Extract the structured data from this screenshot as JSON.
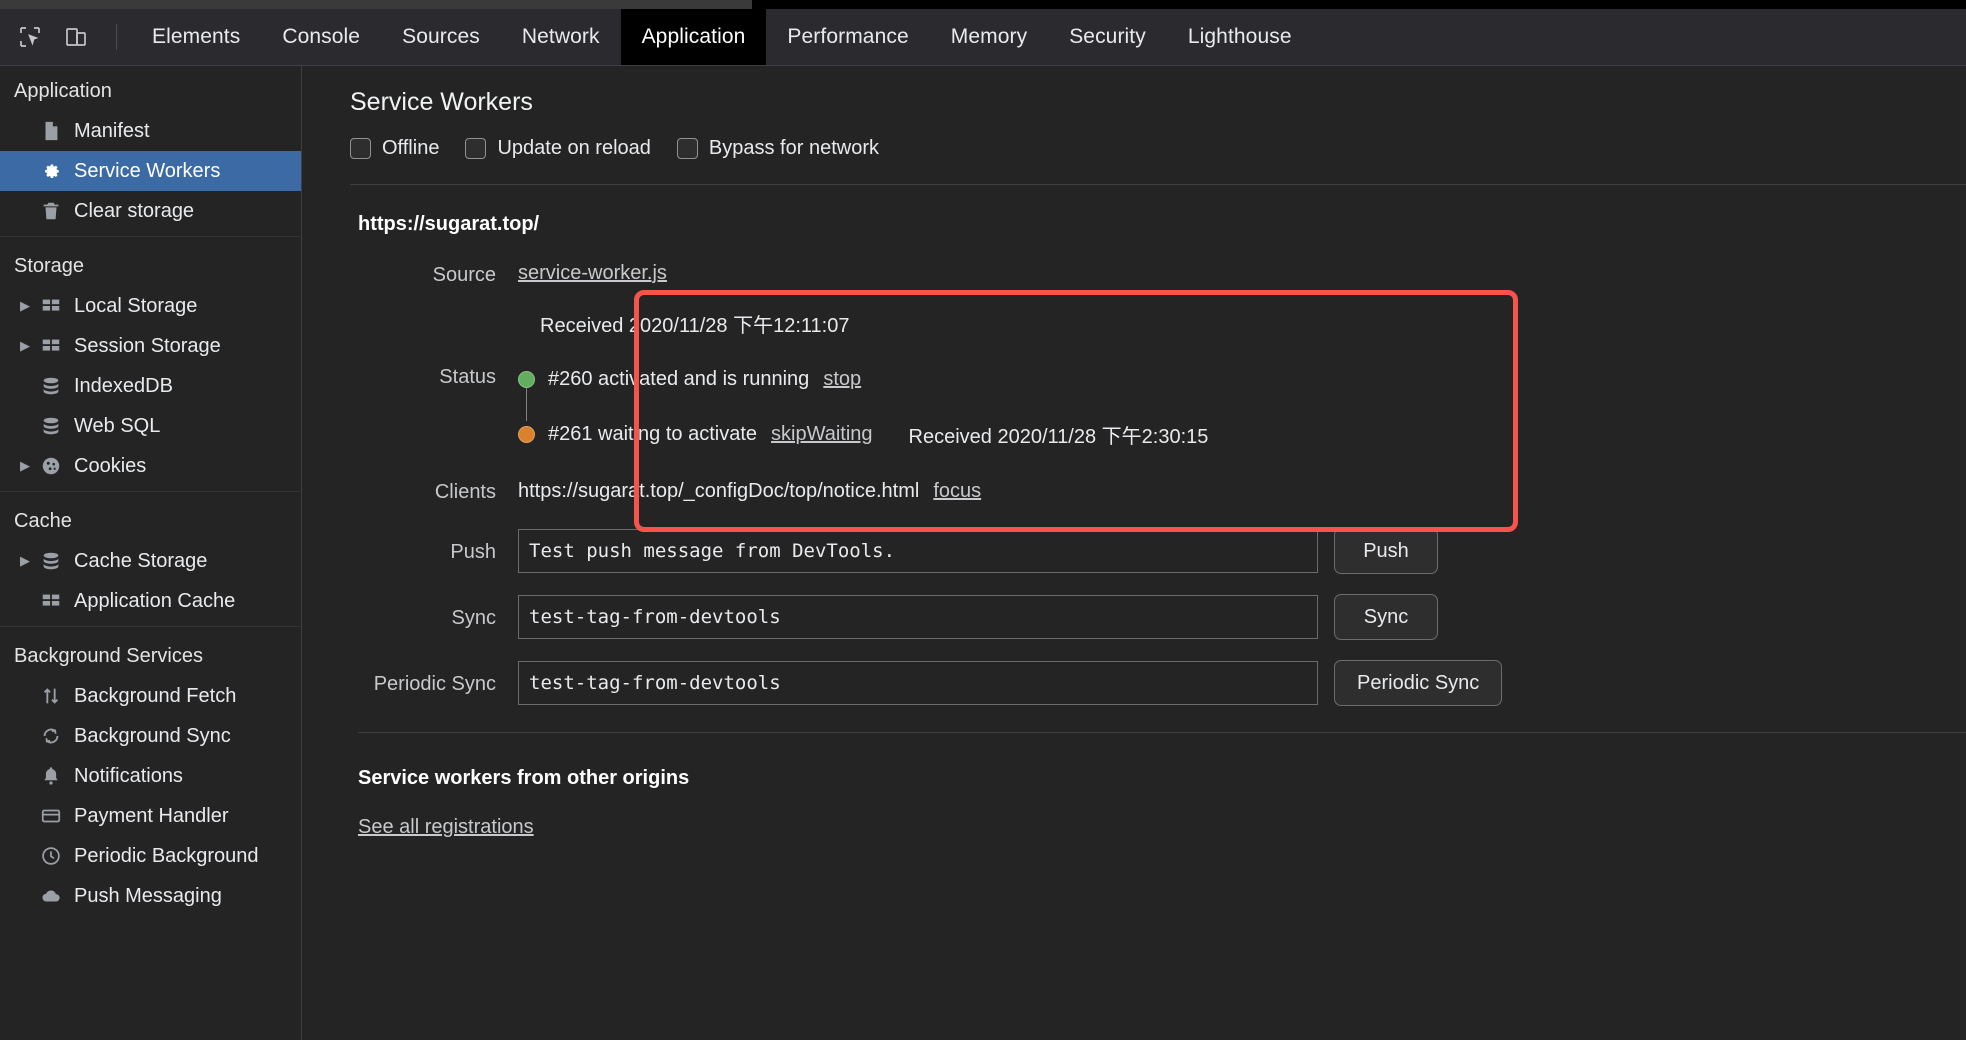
{
  "window": {
    "tools": [
      {
        "name": "inspect-element-icon",
        "title": "Inspect element"
      },
      {
        "name": "device-toolbar-icon",
        "title": "Toggle device toolbar"
      }
    ]
  },
  "tabs": [
    {
      "label": "Elements",
      "active": false
    },
    {
      "label": "Console",
      "active": false
    },
    {
      "label": "Sources",
      "active": false
    },
    {
      "label": "Network",
      "active": false
    },
    {
      "label": "Application",
      "active": true
    },
    {
      "label": "Performance",
      "active": false
    },
    {
      "label": "Memory",
      "active": false
    },
    {
      "label": "Security",
      "active": false
    },
    {
      "label": "Lighthouse",
      "active": false
    }
  ],
  "sidebar": {
    "groups": [
      {
        "header": "Application",
        "items": [
          {
            "label": "Manifest",
            "icon": "document-icon",
            "twisty": false,
            "selected": false
          },
          {
            "label": "Service Workers",
            "icon": "gear-icon",
            "twisty": false,
            "selected": true
          },
          {
            "label": "Clear storage",
            "icon": "trash-icon",
            "twisty": false,
            "selected": false
          }
        ]
      },
      {
        "header": "Storage",
        "items": [
          {
            "label": "Local Storage",
            "icon": "table-icon",
            "twisty": true,
            "selected": false
          },
          {
            "label": "Session Storage",
            "icon": "table-icon",
            "twisty": true,
            "selected": false
          },
          {
            "label": "IndexedDB",
            "icon": "database-icon",
            "twisty": false,
            "selected": false
          },
          {
            "label": "Web SQL",
            "icon": "database-icon",
            "twisty": false,
            "selected": false
          },
          {
            "label": "Cookies",
            "icon": "cookie-icon",
            "twisty": true,
            "selected": false
          }
        ]
      },
      {
        "header": "Cache",
        "items": [
          {
            "label": "Cache Storage",
            "icon": "database-icon",
            "twisty": true,
            "selected": false
          },
          {
            "label": "Application Cache",
            "icon": "table-icon",
            "twisty": false,
            "selected": false
          }
        ]
      },
      {
        "header": "Background Services",
        "items": [
          {
            "label": "Background Fetch",
            "icon": "fetch-arrows-icon",
            "twisty": false,
            "selected": false
          },
          {
            "label": "Background Sync",
            "icon": "sync-icon",
            "twisty": false,
            "selected": false
          },
          {
            "label": "Notifications",
            "icon": "bell-icon",
            "twisty": false,
            "selected": false
          },
          {
            "label": "Payment Handler",
            "icon": "credit-card-icon",
            "twisty": false,
            "selected": false
          },
          {
            "label": "Periodic Background",
            "icon": "clock-icon",
            "twisty": false,
            "selected": false
          },
          {
            "label": "Push Messaging",
            "icon": "cloud-icon",
            "twisty": false,
            "selected": false
          }
        ]
      }
    ]
  },
  "main": {
    "title": "Service Workers",
    "checkboxes": [
      {
        "label": "Offline",
        "checked": false
      },
      {
        "label": "Update on reload",
        "checked": false
      },
      {
        "label": "Bypass for network",
        "checked": false
      }
    ],
    "registration": {
      "origin": "https://sugarat.top/",
      "source_label": "Source",
      "source_link": "service-worker.js",
      "source_received": "Received 2020/11/28 下午12:11:07",
      "status_label": "Status",
      "statuses": [
        {
          "dot": "green",
          "text": "#260 activated and is running",
          "action": "stop",
          "received": ""
        },
        {
          "dot": "orange",
          "text": "#261 waiting to activate",
          "action": "skipWaiting",
          "received": "Received 2020/11/28 下午2:30:15"
        }
      ],
      "clients_label": "Clients",
      "clients_url": "https://sugarat.top/_configDoc/top/notice.html",
      "clients_action": "focus",
      "push_label": "Push",
      "push_value": "Test push message from DevTools.",
      "push_button": "Push",
      "sync_label": "Sync",
      "sync_value": "test-tag-from-devtools",
      "sync_button": "Sync",
      "periodic_label": "Periodic Sync",
      "periodic_value": "test-tag-from-devtools",
      "periodic_button": "Periodic Sync"
    },
    "other_origins": {
      "title": "Service workers from other origins",
      "link": "See all registrations"
    }
  },
  "annotation": {
    "name": "red-highlight-box",
    "color": "#f4544c"
  }
}
